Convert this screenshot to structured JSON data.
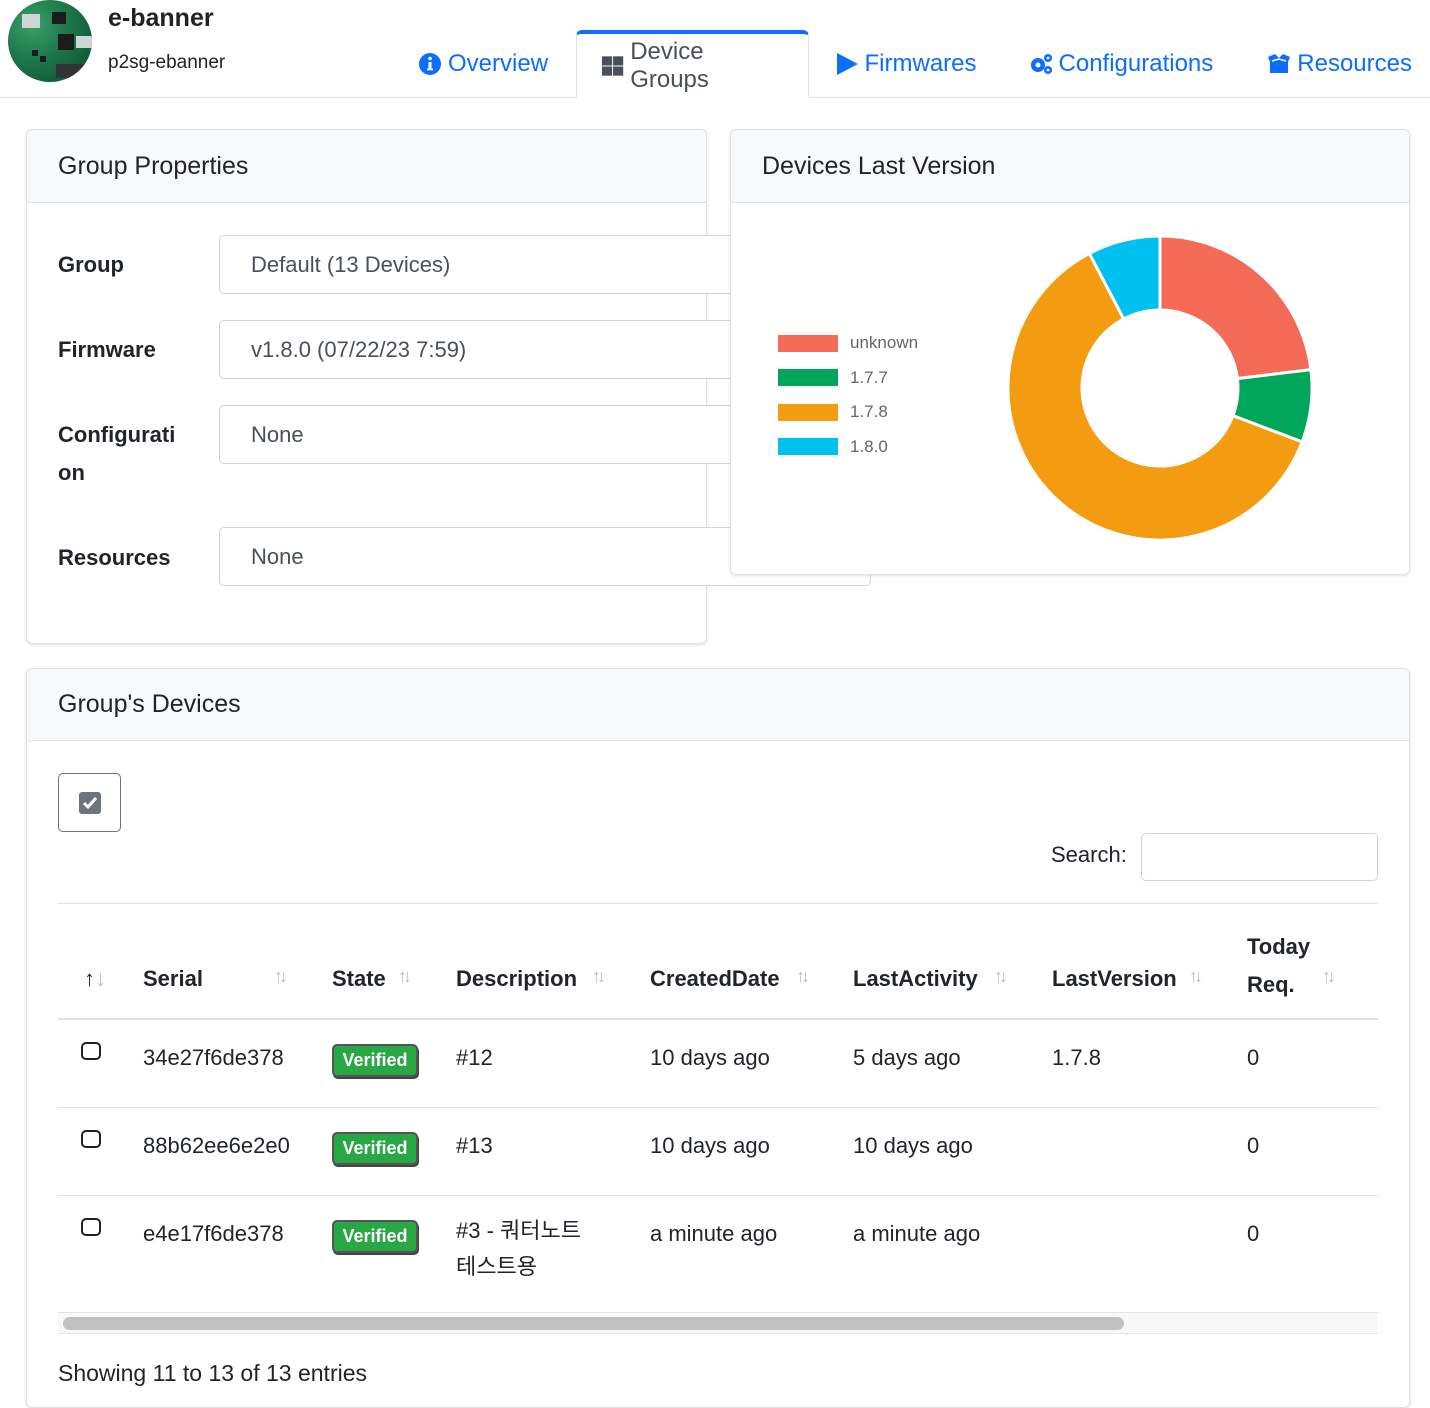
{
  "header": {
    "app_name": "e-banner",
    "app_id": "p2sg-ebanner",
    "tabs": [
      {
        "label": "Overview",
        "icon": "info-circle-icon",
        "active": false
      },
      {
        "label": "Device Groups",
        "icon": "grid-icon",
        "active": true
      },
      {
        "label": "Firmwares",
        "icon": "play-icon",
        "active": false
      },
      {
        "label": "Configurations",
        "icon": "gears-icon",
        "active": false
      },
      {
        "label": "Resources",
        "icon": "box-open-icon",
        "active": false
      }
    ]
  },
  "group_properties": {
    "title": "Group Properties",
    "fields": [
      {
        "label": "Group",
        "value": "Default (13 Devices)"
      },
      {
        "label": "Firmware",
        "value": "v1.8.0 (07/22/23 7:59)"
      },
      {
        "label": "Configuration",
        "label_line1": "Configurati",
        "label_line2": "on",
        "value": "None"
      },
      {
        "label": "Resources",
        "value": "None"
      }
    ]
  },
  "chart_data": {
    "type": "pie",
    "title": "Devices Last Version",
    "donut": true,
    "legend_position": "left",
    "categories": [
      "unknown",
      "1.7.7",
      "1.7.8",
      "1.8.0"
    ],
    "values": [
      3,
      1,
      8,
      1
    ],
    "colors": [
      "#f36a56",
      "#00a65a",
      "#f39c12",
      "#00c0ef"
    ]
  },
  "devices": {
    "title": "Group's Devices",
    "search_label": "Search:",
    "search_value": "",
    "columns": [
      "",
      "Serial",
      "State",
      "Description",
      "CreatedDate",
      "LastActivity",
      "LastVersion",
      "Today Req."
    ],
    "column_today_line1": "Today",
    "column_today_line2": "Req.",
    "rows": [
      {
        "serial": "34e27f6de378",
        "state": "Verified",
        "description": "#12",
        "created": "10 days ago",
        "last_activity": "5 days ago",
        "last_version": "1.7.8",
        "today_req": "0"
      },
      {
        "serial": "88b62ee6e2e0",
        "state": "Verified",
        "description": "#13",
        "created": "10 days ago",
        "last_activity": "10 days ago",
        "last_version": "",
        "today_req": "0"
      },
      {
        "serial": "e4e17f6de378",
        "state": "Verified",
        "description": "#3 - 쿼터노트 테스트용",
        "description_line1": "#3 - 쿼터노트",
        "description_line2": "테스트용",
        "created": "a minute ago",
        "last_activity": "a minute ago",
        "last_version": "",
        "today_req": "0"
      }
    ],
    "info": "Showing 11 to 13 of 13 entries"
  }
}
